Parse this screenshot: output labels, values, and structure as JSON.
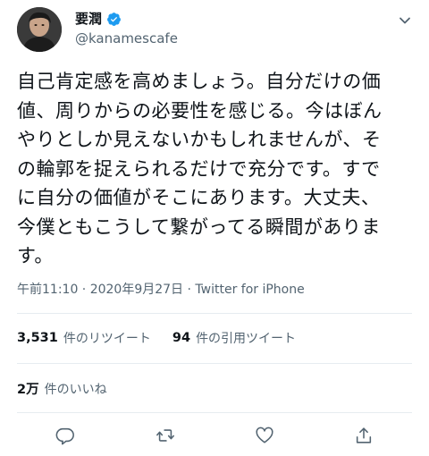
{
  "author": {
    "display_name": "要潤",
    "handle": "@kanamescafe",
    "verified_icon": "verified-badge-icon",
    "avatar_icon": "avatar"
  },
  "tweet": {
    "lines": [
      "自己肯定感を高めましょう。自分だけの価",
      "値、周りからの必要性を感じる。今はぼん",
      "やりとしか見えないかもしれませんが、そ",
      "の輪郭を捉えられるだけで充分です。すで",
      "に自分の価値がそこにあります。大丈夫、",
      "今僕ともこうして繋がってる瞬間がありま",
      "す。"
    ],
    "timestamp": "午前11:10 · 2020年9月27日 · ",
    "source": "Twitter for iPhone"
  },
  "stats": {
    "retweets_count": "3,531",
    "retweets_label": "件のリツイート",
    "quotes_count": "94",
    "quotes_label": "件の引用ツイート",
    "likes_count": "2万",
    "likes_label": "件のいいね"
  },
  "colors": {
    "accent": "#1d9bf0",
    "secondary_text": "#536471",
    "divider": "#e6ecf0"
  },
  "icons": {
    "caret": "chevron-down-icon",
    "reply": "reply-icon",
    "retweet": "retweet-icon",
    "like": "heart-icon",
    "share": "share-icon"
  }
}
